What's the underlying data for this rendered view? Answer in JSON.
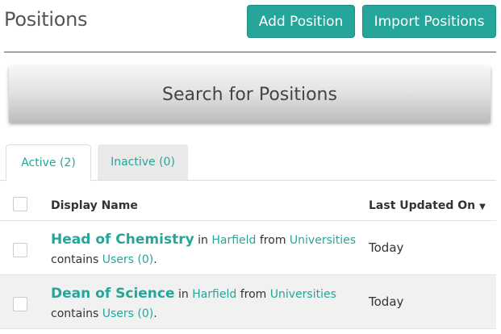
{
  "header": {
    "title": "Positions",
    "add_label": "Add Position",
    "import_label": "Import Positions"
  },
  "search": {
    "label": "Search for Positions"
  },
  "tabs": [
    {
      "label": "Active (2)",
      "active": true
    },
    {
      "label": "Inactive (0)",
      "active": false
    }
  ],
  "table": {
    "columns": {
      "name": "Display Name",
      "updated": "Last Updated On"
    },
    "rows": [
      {
        "name": "Head of Chemistry",
        "in_word": "in",
        "location": "Harfield",
        "from_word": "from",
        "org": "Universities",
        "contains_word": "contains",
        "users": "Users (0)",
        "updated": "Today"
      },
      {
        "name": "Dean of Science",
        "in_word": "in",
        "location": "Harfield",
        "from_word": "from",
        "org": "Universities",
        "contains_word": "contains",
        "users": "Users (0)",
        "updated": "Today"
      }
    ]
  },
  "colors": {
    "accent": "#26a69a",
    "row_alt": "#f1f1f1"
  },
  "icons": {
    "sort": "sort-down-icon"
  }
}
